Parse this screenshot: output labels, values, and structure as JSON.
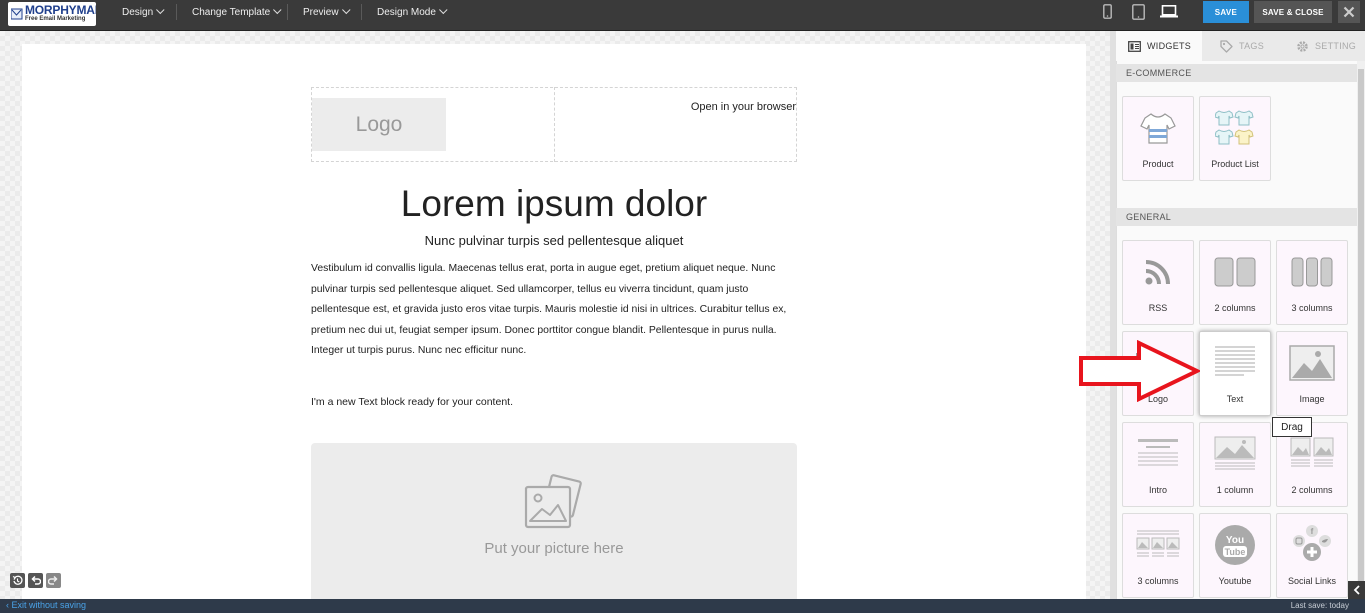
{
  "brand": {
    "name": "MORPHYMAIL",
    "tagline": "Free Email Marketing"
  },
  "topbar": {
    "menus": [
      "Design",
      "Change Template",
      "Preview",
      "Design Mode"
    ],
    "devices": [
      "mobile-icon",
      "tablet-icon",
      "desktop-icon"
    ],
    "save_label": "SAVE",
    "save_close_label": "SAVE & CLOSE",
    "accent": "#2a8fd8"
  },
  "email": {
    "logo_placeholder": "Logo",
    "open_browser": "Open in your browser",
    "title": "Lorem ipsum dolor",
    "subtitle": "Nunc pulvinar turpis sed pellentesque aliquet",
    "body": "Vestibulum id convallis ligula. Maecenas tellus erat, porta in augue eget, pretium aliquet neque. Nunc pulvinar turpis sed pellentesque aliquet. Sed ullamcorper, tellus eu viverra tincidunt, quam justo pellentesque est, et gravida justo eros vitae turpis. Mauris molestie id nisi in ultrices. Curabitur tellus ex, pretium nec dui ut, feugiat semper ipsum. Donec porttitor congue blandit. Pellentesque in purus nulla. Integer ut turpis purus. Nunc nec efficitur nunc.",
    "new_text_block": "I'm a new Text block ready for your content.",
    "picture_placeholder": "Put your picture here"
  },
  "panel": {
    "tabs": [
      "WIDGETS",
      "TAGS",
      "SETTING"
    ],
    "ecommerce": {
      "heading": "E-COMMERCE",
      "widgets": [
        "Product",
        "Product List"
      ]
    },
    "general": {
      "heading": "GENERAL",
      "widgets": [
        "RSS",
        "2 columns",
        "3 columns",
        "Logo",
        "Text",
        "Image",
        "Intro",
        "1 column",
        "2 columns",
        "3 columns",
        "Youtube",
        "Social Links"
      ]
    },
    "tooltip": "Drag",
    "highlight_color": "#e8141d"
  },
  "status": {
    "exit_label": "Exit without saving",
    "last_save": "Last save: today"
  }
}
